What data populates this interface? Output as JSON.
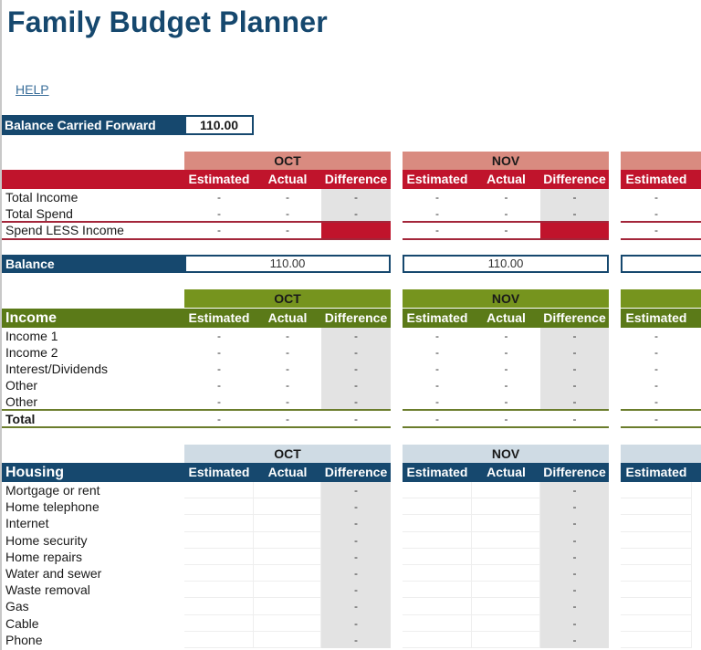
{
  "title": "Family Budget Planner",
  "help_link": "HELP",
  "balance_carried_forward": {
    "label": "Balance Carried Forward",
    "value": "110.00"
  },
  "colors": {
    "brand_blue": "#16486e",
    "summary_red": "#c0142c",
    "summary_month_bg": "#d98b80",
    "income_green": "#5b7a18",
    "income_month_bg": "#76941e",
    "housing_month_bg": "#cfdbe4",
    "difference_bg": "#e3e3e3"
  },
  "months": [
    "OCT",
    "NOV",
    ""
  ],
  "column_headers": {
    "estimated": "Estimated",
    "actual": "Actual",
    "difference": "Difference"
  },
  "summary": {
    "rows": [
      {
        "label": "Total Income",
        "values": [
          [
            "-",
            "-",
            "-"
          ],
          [
            "-",
            "-",
            "-"
          ],
          [
            "-"
          ]
        ]
      },
      {
        "label": "Total Spend",
        "values": [
          [
            "-",
            "-",
            "-"
          ],
          [
            "-",
            "-",
            "-"
          ],
          [
            "-"
          ]
        ]
      },
      {
        "label": "Spend LESS Income",
        "values": [
          [
            "-",
            "-",
            ""
          ],
          [
            "-",
            "-",
            ""
          ],
          [
            "-"
          ]
        ]
      }
    ],
    "balance": {
      "label": "Balance",
      "values": [
        "110.00",
        "110.00",
        ""
      ]
    }
  },
  "income": {
    "title": "Income",
    "rows": [
      {
        "label": "Income 1",
        "values": [
          [
            "-",
            "-",
            "-"
          ],
          [
            "-",
            "-",
            "-"
          ],
          [
            "-"
          ]
        ]
      },
      {
        "label": "Income 2",
        "values": [
          [
            "-",
            "-",
            "-"
          ],
          [
            "-",
            "-",
            "-"
          ],
          [
            "-"
          ]
        ]
      },
      {
        "label": "Interest/Dividends",
        "values": [
          [
            "-",
            "-",
            "-"
          ],
          [
            "-",
            "-",
            "-"
          ],
          [
            "-"
          ]
        ]
      },
      {
        "label": "Other",
        "values": [
          [
            "-",
            "-",
            "-"
          ],
          [
            "-",
            "-",
            "-"
          ],
          [
            "-"
          ]
        ]
      },
      {
        "label": "Other",
        "values": [
          [
            "-",
            "-",
            "-"
          ],
          [
            "-",
            "-",
            "-"
          ],
          [
            "-"
          ]
        ]
      }
    ],
    "total": {
      "label": "Total",
      "values": [
        [
          "-",
          "-",
          "-"
        ],
        [
          "-",
          "-",
          "-"
        ],
        [
          "-"
        ]
      ]
    }
  },
  "housing": {
    "title": "Housing",
    "rows": [
      {
        "label": "Mortgage or rent",
        "values": [
          [
            "",
            "",
            "-"
          ],
          [
            "",
            "",
            "-"
          ],
          [
            ""
          ]
        ]
      },
      {
        "label": "Home telephone",
        "values": [
          [
            "",
            "",
            "-"
          ],
          [
            "",
            "",
            "-"
          ],
          [
            ""
          ]
        ]
      },
      {
        "label": "Internet",
        "values": [
          [
            "",
            "",
            "-"
          ],
          [
            "",
            "",
            "-"
          ],
          [
            ""
          ]
        ]
      },
      {
        "label": "Home security",
        "values": [
          [
            "",
            "",
            "-"
          ],
          [
            "",
            "",
            "-"
          ],
          [
            ""
          ]
        ]
      },
      {
        "label": "Home repairs",
        "values": [
          [
            "",
            "",
            "-"
          ],
          [
            "",
            "",
            "-"
          ],
          [
            ""
          ]
        ]
      },
      {
        "label": "Water and sewer",
        "values": [
          [
            "",
            "",
            "-"
          ],
          [
            "",
            "",
            "-"
          ],
          [
            ""
          ]
        ]
      },
      {
        "label": "Waste removal",
        "values": [
          [
            "",
            "",
            "-"
          ],
          [
            "",
            "",
            "-"
          ],
          [
            ""
          ]
        ]
      },
      {
        "label": "Gas",
        "values": [
          [
            "",
            "",
            "-"
          ],
          [
            "",
            "",
            "-"
          ],
          [
            ""
          ]
        ]
      },
      {
        "label": "Cable",
        "values": [
          [
            "",
            "",
            "-"
          ],
          [
            "",
            "",
            "-"
          ],
          [
            ""
          ]
        ]
      },
      {
        "label": "Phone",
        "values": [
          [
            "",
            "",
            "-"
          ],
          [
            "",
            "",
            "-"
          ],
          [
            ""
          ]
        ]
      }
    ]
  }
}
